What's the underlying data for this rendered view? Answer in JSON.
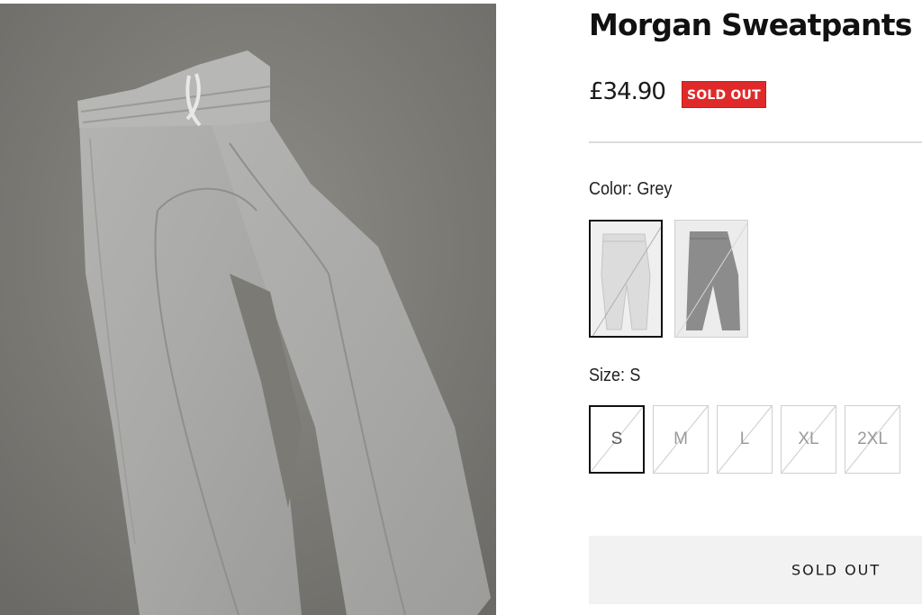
{
  "product": {
    "title": "Morgan Sweatpants",
    "price": "£34.90",
    "badge": "SOLD OUT",
    "badge_color": "#e02a2a",
    "image_icon": "sweatpants-photo"
  },
  "color_option": {
    "label": "Color:",
    "selected": "Grey",
    "swatches": [
      {
        "name": "Grey",
        "selected": true,
        "icon": "light-grey-sweatpants-thumbnail"
      },
      {
        "name": "Dark Grey",
        "selected": false,
        "icon": "dark-grey-sweatpants-thumbnail"
      }
    ]
  },
  "size_option": {
    "label": "Size:",
    "selected": "S",
    "sizes": [
      "S",
      "M",
      "L",
      "XL",
      "2XL"
    ],
    "all_unavailable": true
  },
  "cta": {
    "label": "SOLD OUT",
    "background": "#f2f2f2"
  }
}
